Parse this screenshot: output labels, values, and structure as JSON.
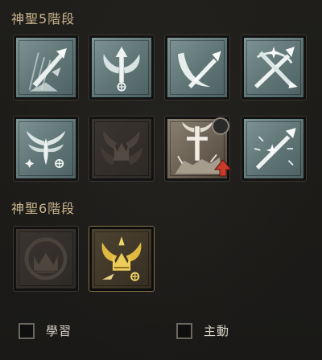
{
  "sections": [
    {
      "title": "神聖5階段",
      "skills": [
        {
          "icon": "falling-spear-icon",
          "state": "active"
        },
        {
          "icon": "winged-arrow-icon",
          "state": "active"
        },
        {
          "icon": "crescent-spear-icon",
          "state": "active"
        },
        {
          "icon": "crossed-spears-icon",
          "state": "active"
        },
        {
          "icon": "winged-star-icon",
          "state": "active"
        },
        {
          "icon": "winged-crown-icon",
          "state": "locked"
        },
        {
          "icon": "sword-in-stone-icon",
          "state": "special"
        },
        {
          "icon": "radiant-spear-icon",
          "state": "active"
        }
      ]
    },
    {
      "title": "神聖6階段",
      "skills": [
        {
          "icon": "crown-circle-icon",
          "state": "locked"
        },
        {
          "icon": "golden-winged-crown-icon",
          "state": "gold"
        }
      ]
    }
  ],
  "filters": {
    "learned_label": "學習",
    "active_label": "主動"
  },
  "colors": {
    "title": "#c9b48d",
    "tile_active": "#6c8282",
    "gold_accent": "#e8c24a",
    "arrow_red": "#c83a2a"
  }
}
